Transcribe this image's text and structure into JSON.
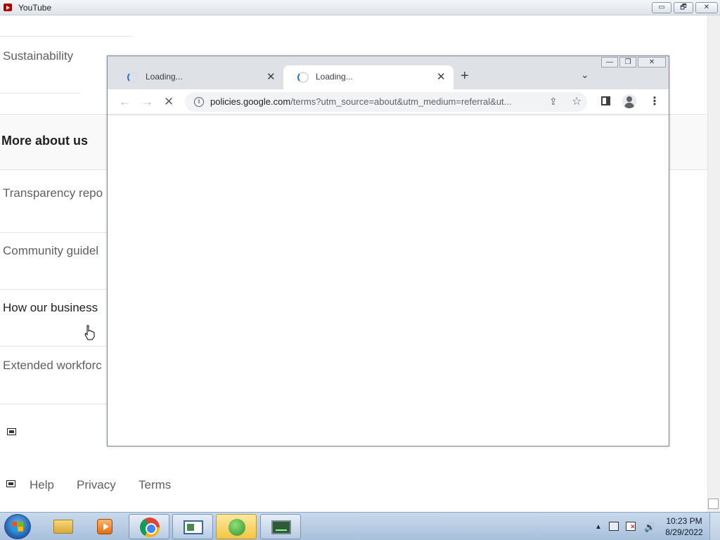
{
  "background_window": {
    "title": "YouTube",
    "caption_buttons": {
      "minimize": "▭",
      "restore": "🗗",
      "close": "✕"
    },
    "links": [
      {
        "label": "Sustainability",
        "style": "muted"
      },
      {
        "label": "Transparency repo",
        "style": "muted"
      },
      {
        "label": "Community guidel",
        "style": "muted"
      },
      {
        "label": "How our business",
        "style": "dark"
      },
      {
        "label": "Extended workforc",
        "style": "muted"
      }
    ],
    "section_header": "More about us",
    "footer": {
      "help": "Help",
      "privacy": "Privacy",
      "terms": "Terms"
    }
  },
  "browser": {
    "caption_buttons": {
      "minimize": "—",
      "restore": "❐",
      "close": "✕"
    },
    "tabs": [
      {
        "title": "Loading...",
        "close": "✕",
        "active": false
      },
      {
        "title": "Loading...",
        "close": "✕",
        "active": true
      }
    ],
    "new_tab": "+",
    "tab_search": "⌄",
    "toolbar": {
      "back": "←",
      "forward": "→",
      "stop": "✕"
    },
    "address": {
      "host": "policies.google.com",
      "rest": "/terms?utm_source=about&utm_medium=referral&ut..."
    },
    "icons": [
      "info-icon",
      "share-icon",
      "star-icon",
      "side-panel-icon",
      "profile-icon",
      "menu-icon"
    ],
    "star": "☆",
    "share": "⇪",
    "menu": "⋮"
  },
  "taskbar": {
    "apps": [
      "windows-explorer",
      "media-center",
      "google-chrome",
      "app-window",
      "network-app",
      "terminal-app"
    ],
    "tray": {
      "arrow": "▲",
      "volume": "🔊"
    },
    "clock": {
      "time": "10:23 PM",
      "date": "8/29/2022"
    }
  }
}
